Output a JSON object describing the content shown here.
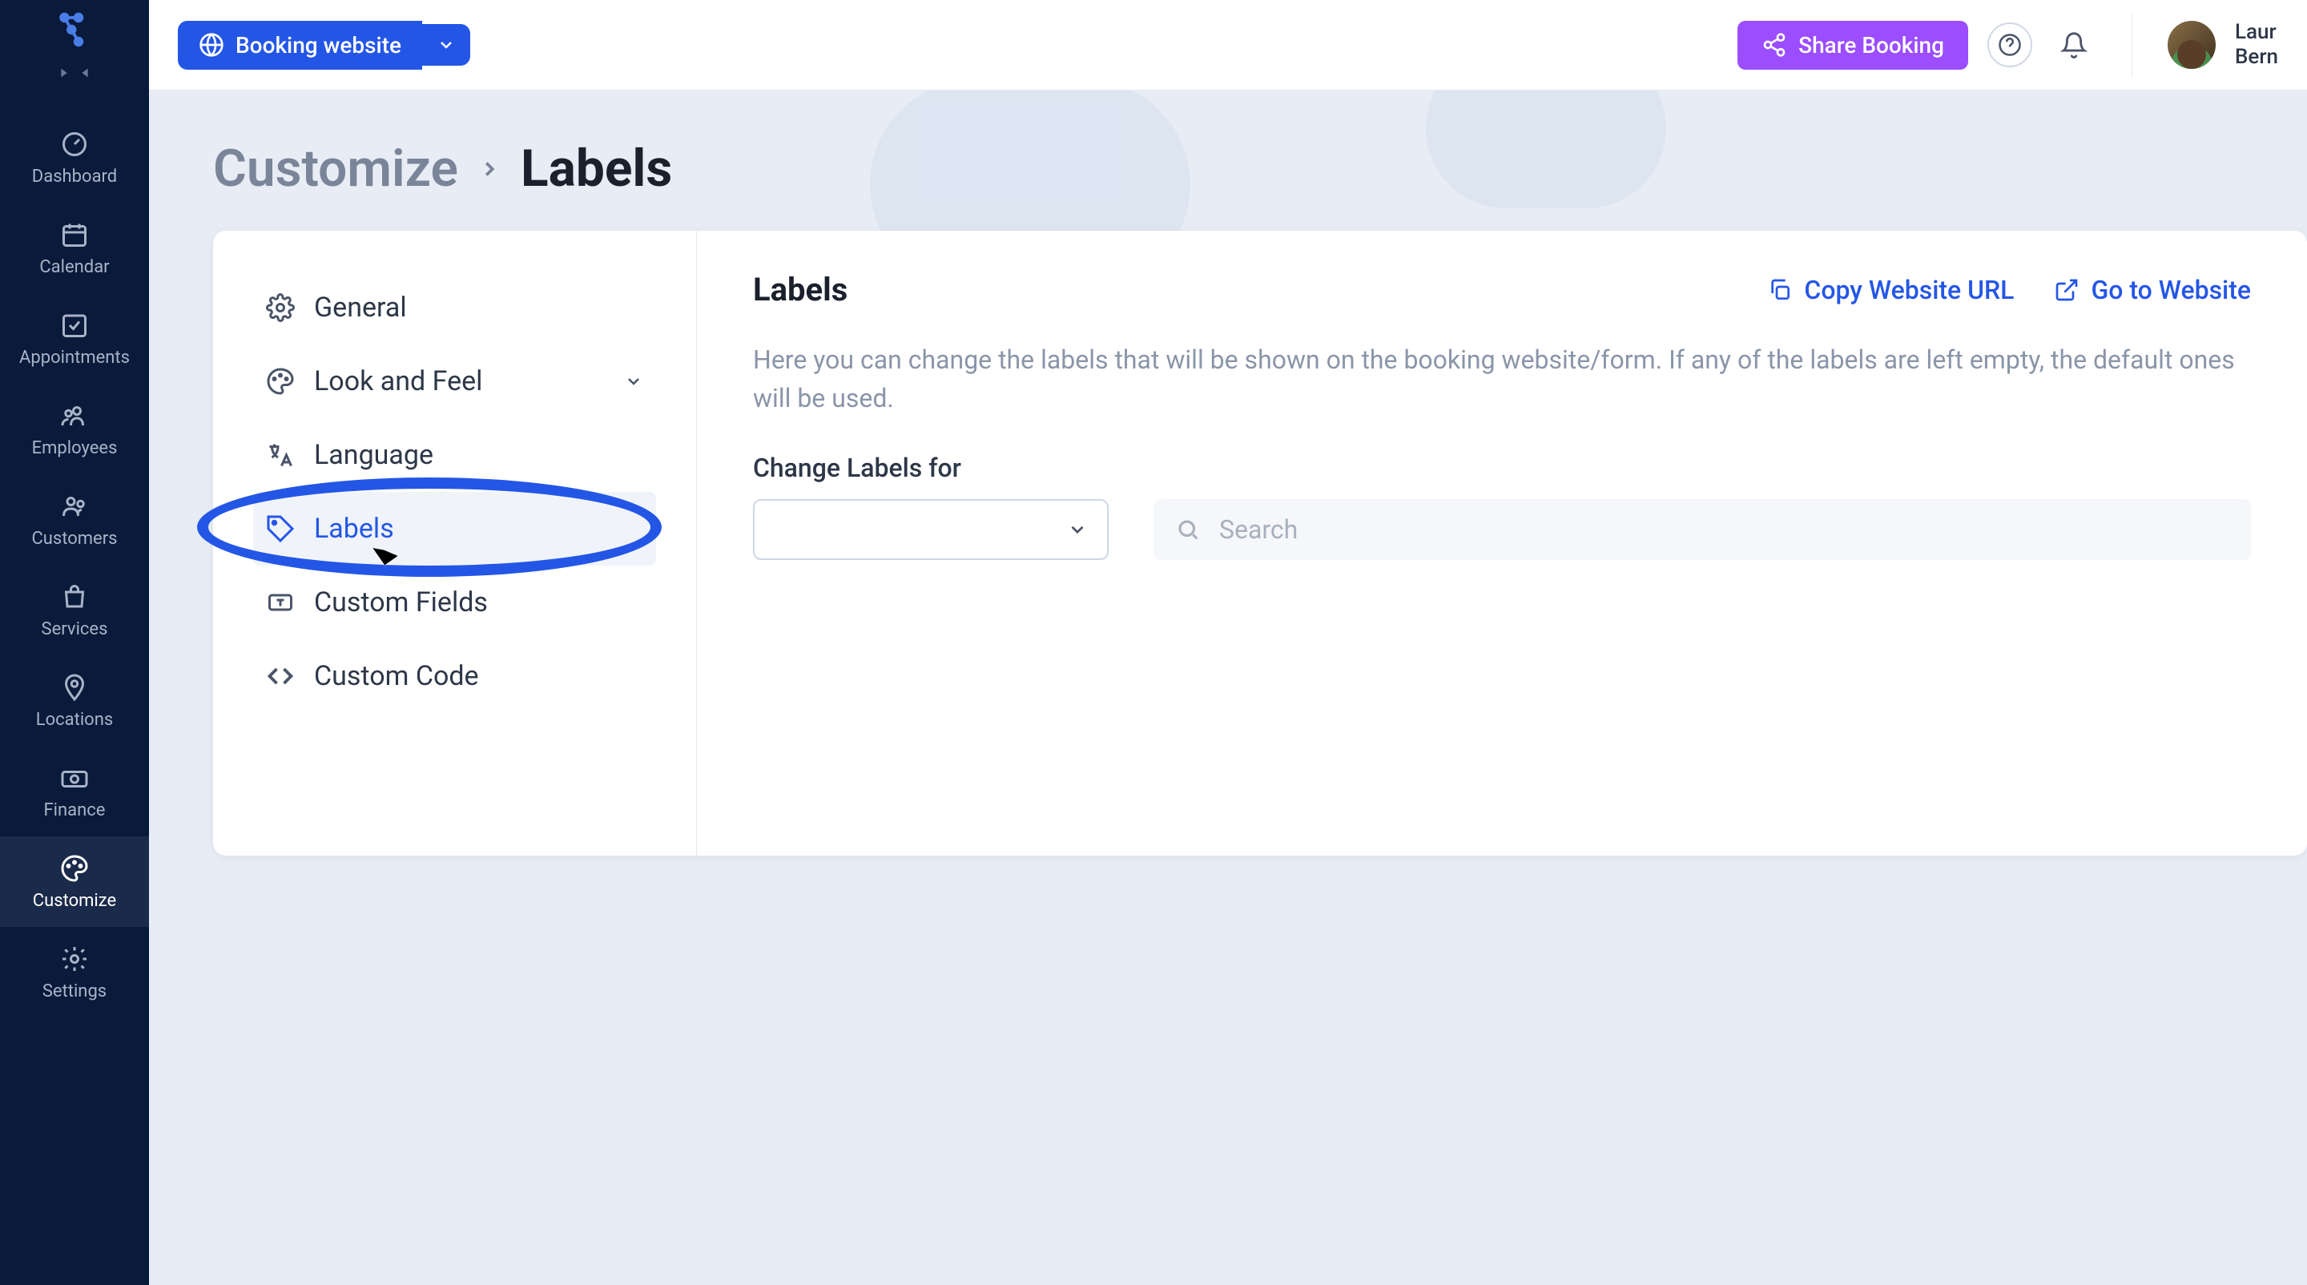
{
  "sidebar": {
    "items": [
      {
        "label": "Dashboard"
      },
      {
        "label": "Calendar"
      },
      {
        "label": "Appointments"
      },
      {
        "label": "Employees"
      },
      {
        "label": "Customers"
      },
      {
        "label": "Services"
      },
      {
        "label": "Locations"
      },
      {
        "label": "Finance"
      },
      {
        "label": "Customize"
      },
      {
        "label": "Settings"
      }
    ]
  },
  "topbar": {
    "booking_label": "Booking website",
    "share_label": "Share Booking",
    "user_name_line1": "Laur",
    "user_name_line2": "Bern"
  },
  "breadcrumb": {
    "parent": "Customize",
    "current": "Labels"
  },
  "card": {
    "nav": [
      {
        "label": "General"
      },
      {
        "label": "Look and Feel"
      },
      {
        "label": "Language"
      },
      {
        "label": "Labels"
      },
      {
        "label": "Custom Fields"
      },
      {
        "label": "Custom Code"
      }
    ],
    "title": "Labels",
    "actions": {
      "copy_url": "Copy Website URL",
      "go_website": "Go to Website"
    },
    "description": "Here you can change the labels that will be shown on the booking website/form. If any of the labels are left empty, the default ones will be used.",
    "form": {
      "change_labels_for": "Change Labels for",
      "search_placeholder": "Search"
    }
  }
}
